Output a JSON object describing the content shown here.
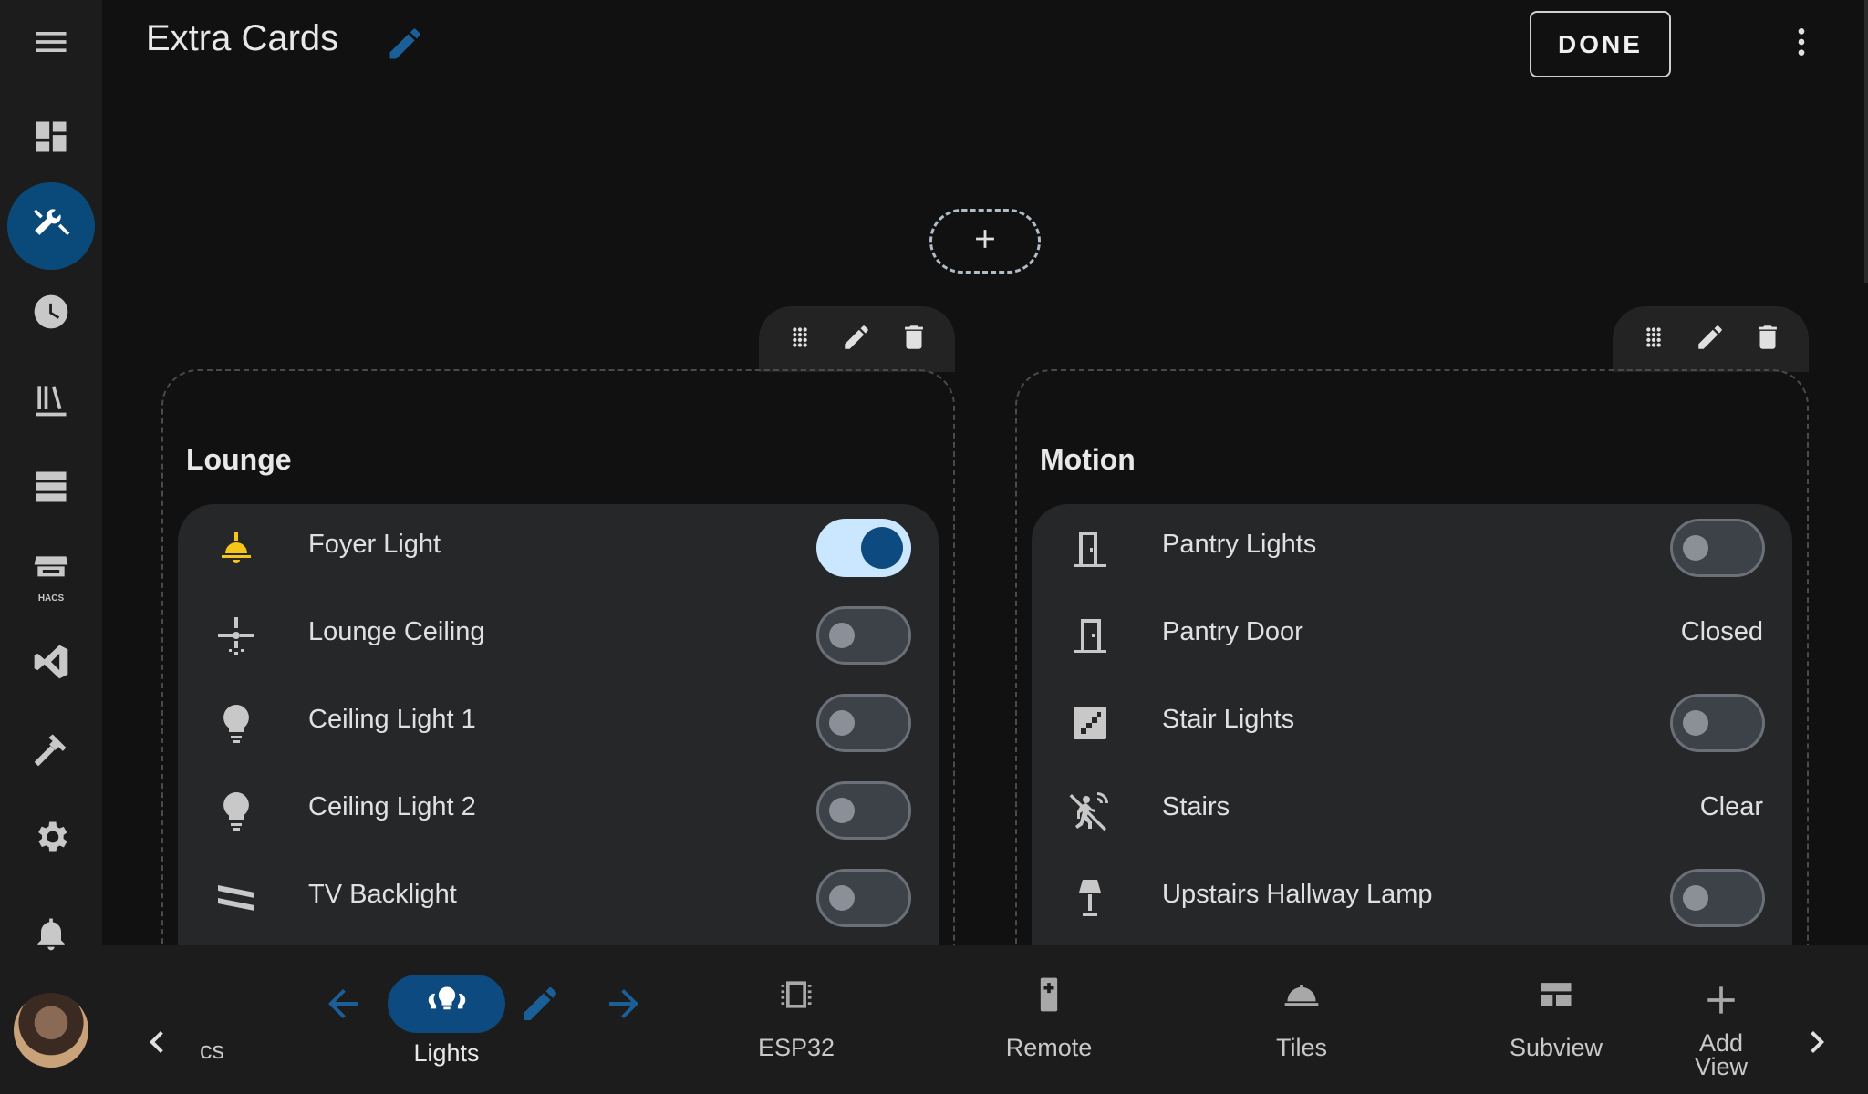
{
  "header": {
    "title": "Extra Cards",
    "done_label": "DONE"
  },
  "sidebar": {
    "items": [
      {
        "name": "menu",
        "icon": "menu-icon"
      },
      {
        "name": "overview",
        "icon": "dashboard-icon"
      },
      {
        "name": "tools",
        "icon": "tools-icon",
        "active": true
      },
      {
        "name": "history",
        "icon": "clock-icon"
      },
      {
        "name": "logbook",
        "icon": "library-icon"
      },
      {
        "name": "servers",
        "icon": "server-icon"
      },
      {
        "name": "hacs",
        "icon": "hacs-store-icon",
        "label": "HACS"
      },
      {
        "name": "vscode",
        "icon": "vscode-icon"
      },
      {
        "name": "developer-tools",
        "icon": "hammer-icon"
      },
      {
        "name": "settings",
        "icon": "gear-icon"
      },
      {
        "name": "notifications",
        "icon": "bell-icon"
      }
    ],
    "accent_color": "#0a4a7a"
  },
  "sections": [
    {
      "title": "Lounge",
      "rows": [
        {
          "name": "Foyer Light",
          "icon": "ceiling-light-icon",
          "toggle": true,
          "on": true
        },
        {
          "name": "Lounge Ceiling",
          "icon": "ceiling-fan-light-icon",
          "toggle": true,
          "on": false
        },
        {
          "name": "Ceiling Light 1",
          "icon": "lightbulb-icon",
          "toggle": true,
          "on": false
        },
        {
          "name": "Ceiling Light 2",
          "icon": "lightbulb-icon",
          "toggle": true,
          "on": false
        },
        {
          "name": "TV Backlight",
          "icon": "led-strip-icon",
          "toggle": true,
          "on": false
        }
      ]
    },
    {
      "title": "Motion",
      "rows": [
        {
          "name": "Pantry Lights",
          "icon": "door-light-icon",
          "toggle": true,
          "on": false
        },
        {
          "name": "Pantry Door",
          "icon": "door-icon",
          "state": "Closed"
        },
        {
          "name": "Stair Lights",
          "icon": "stairs-icon",
          "toggle": true,
          "on": false
        },
        {
          "name": "Stairs",
          "icon": "motion-sensor-off-icon",
          "state": "Clear"
        },
        {
          "name": "Upstairs Hallway Lamp",
          "icon": "lamp-icon",
          "toggle": true,
          "on": false
        }
      ]
    }
  ],
  "views": {
    "prev_cut_label": "cs",
    "active": {
      "label": "Lights",
      "icon": "lights-group-icon"
    },
    "items": [
      {
        "label": "ESP32",
        "icon": "chip-icon"
      },
      {
        "label": "Remote",
        "icon": "remote-icon"
      },
      {
        "label": "Tiles",
        "icon": "room-service-icon"
      },
      {
        "label": "Subview",
        "icon": "view-dashboard-icon"
      }
    ],
    "add_view_line1": "Add",
    "add_view_line2": "View"
  },
  "colors": {
    "background": "#111111",
    "card": "#262729",
    "toggle_on_track": "#cbe6ff",
    "toggle_on_knob": "#0c4a80",
    "icon_on": "#f5c518"
  }
}
